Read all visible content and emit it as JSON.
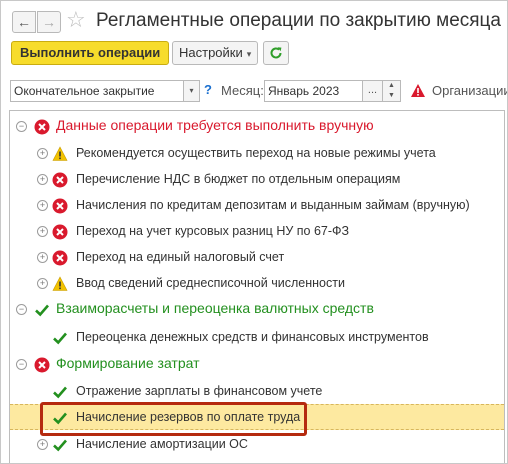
{
  "window": {
    "title": "Регламентные операции по закрытию месяца"
  },
  "nav": {
    "back_glyph": "←",
    "forward_glyph": "→",
    "star_glyph": "☆"
  },
  "toolbar": {
    "run_label": "Выполнить операции",
    "settings_label": "Настройки",
    "settings_caret": "▾"
  },
  "filters": {
    "mode_value": "Окончательное закрытие",
    "mode_caret": "▾",
    "help_glyph": "?",
    "month_label": "Месяц:",
    "month_value": "Январь 2023",
    "month_dots": "...",
    "spin_up": "▲",
    "spin_down": "▼",
    "org_label": "Организации:"
  },
  "colors": {
    "error": "#d9192d",
    "success": "#23901f",
    "warning": "#f2c200",
    "primary_button": "#f7dc2b",
    "selection": "#fde9a0",
    "highlight_frame": "#b52a0f"
  },
  "tree": {
    "groups": [
      {
        "label": "Данные операции требуется выполнить вручную",
        "status": "error",
        "expander": "⊖",
        "items": [
          {
            "label": "Рекомендуется осуществить переход на новые режимы учета",
            "status": "warning",
            "expander": "⊕"
          },
          {
            "label": "Перечисление НДС в бюджет по отдельным операциям",
            "status": "error",
            "expander": "⊕"
          },
          {
            "label": "Начисления по кредитам депозитам и выданным займам (вручную)",
            "status": "error",
            "expander": "⊕"
          },
          {
            "label": "Переход на учет курсовых разниц НУ по 67-ФЗ",
            "status": "error",
            "expander": "⊕"
          },
          {
            "label": "Переход на единый налоговый счет",
            "status": "error",
            "expander": "⊕"
          },
          {
            "label": "Ввод сведений среднесписочной численности",
            "status": "warning",
            "expander": "⊕"
          }
        ]
      },
      {
        "label": "Взаиморасчеты и переоценка валютных средств",
        "status": "success",
        "expander": "⊖",
        "items": [
          {
            "label": "Переоценка денежных средств и финансовых инструментов",
            "status": "success",
            "expander": ""
          }
        ]
      },
      {
        "label": "Формирование затрат",
        "status": "error",
        "expander": "⊖",
        "items": [
          {
            "label": "Отражение зарплаты в финансовом учете",
            "status": "success",
            "expander": ""
          },
          {
            "label": "Начисление резервов по оплате труда",
            "status": "success",
            "expander": "",
            "selected": true
          },
          {
            "label": "Начисление амортизации ОС",
            "status": "success",
            "expander": "⊕"
          }
        ]
      }
    ]
  }
}
